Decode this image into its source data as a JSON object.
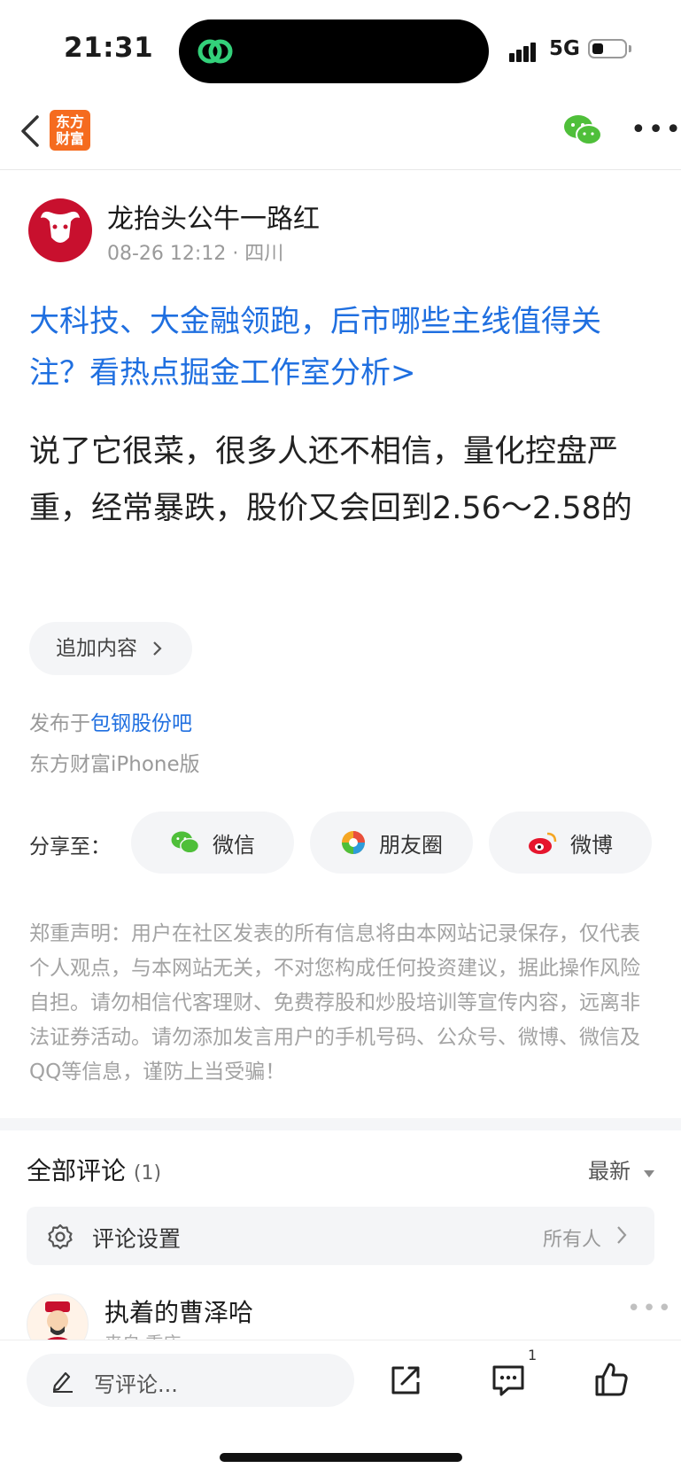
{
  "status": {
    "time": "21:31",
    "network": "5G"
  },
  "nav": {
    "logo_line1": "东方",
    "logo_line2": "财富"
  },
  "post": {
    "author": "龙抬头公牛一路红",
    "meta": "08-26 12:12 · 四川",
    "headline": "大科技、大金融领跑，后市哪些主线值得关注？看热点掘金工作室分析>",
    "body": "说了它很菜，很多人还不相信，量化控盘严重，经常暴跌，股价又会回到2.56～2.58的",
    "append_label": "追加内容",
    "published_prefix": "发布于",
    "published_link": "包钢股份吧",
    "client": "东方财富iPhone版"
  },
  "share": {
    "label": "分享至：",
    "wechat": "微信",
    "moments": "朋友圈",
    "weibo": "微博"
  },
  "disclaimer": "郑重声明：用户在社区发表的所有信息将由本网站记录保存，仅代表个人观点，与本网站无关，不对您构成任何投资建议，据此操作风险自担。请勿相信代客理财、免费荐股和炒股培训等宣传内容，远离非法证券活动。请勿添加发言用户的手机号码、公众号、微博、微信及QQ等信息，谨防上当受骗！",
  "comments": {
    "title": "全部评论",
    "count": "(1)",
    "sort": "最新",
    "settings_label": "评论设置",
    "settings_value": "所有人",
    "items": [
      {
        "name": "执着的曹泽哈",
        "meta": "来自·重庆"
      }
    ]
  },
  "bottom": {
    "placeholder": "写评论...",
    "comment_count": "1"
  },
  "colors": {
    "link_blue": "#1f6fe0",
    "brand_orange": "#f56b1f",
    "wechat_green": "#4fbf3a"
  }
}
